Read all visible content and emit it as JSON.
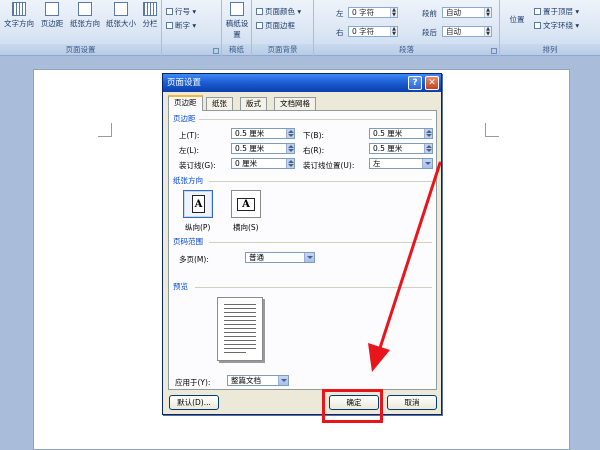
{
  "ribbon": {
    "page_setup": {
      "title": "页面设置",
      "text_direction": "文字方向",
      "margins": "页边距",
      "orientation": "纸张方向",
      "size": "纸张大小",
      "columns": "分栏",
      "line_numbers": "行号",
      "hyphenation": "断字"
    },
    "manuscript": {
      "title": "稿纸",
      "setup": "稿纸设置"
    },
    "page_background": {
      "title": "页面背景",
      "page_color": "页面颜色",
      "page_borders": "页面边框"
    },
    "paragraph": {
      "title": "段落",
      "left_label": "左",
      "left_value": "0 字符",
      "right_label": "右",
      "right_value": "0 字符",
      "before_label": "段前",
      "before_value": "自动",
      "after_label": "段后",
      "after_value": "自动"
    },
    "arrange": {
      "title": "排列",
      "position": "位置",
      "bring_front": "置于顶层",
      "text_wrap": "文字环绕"
    }
  },
  "dialog": {
    "title": "页面设置",
    "tabs": [
      "页边距",
      "纸张",
      "版式",
      "文档网格"
    ],
    "margins_section": "页边距",
    "top_label": "上(T):",
    "top_value": "0.5 厘米",
    "bottom_label": "下(B):",
    "bottom_value": "0.5 厘米",
    "left_label": "左(L):",
    "left_value": "0.5 厘米",
    "right_label": "右(R):",
    "right_value": "0.5 厘米",
    "gutter_label": "装订线(G):",
    "gutter_value": "0 厘米",
    "gutter_pos_label": "装订线位置(U):",
    "gutter_pos_value": "左",
    "orientation_section": "纸张方向",
    "portrait_label": "纵向(P)",
    "landscape_label": "横向(S)",
    "orient_glyph": "A",
    "pages_section": "页码范围",
    "multiple_pages_label": "多页(M):",
    "multiple_pages_value": "普通",
    "preview_section": "预览",
    "apply_to_label": "应用于(Y):",
    "apply_to_value": "整篇文档",
    "default_button": "默认(D)...",
    "ok_button": "确定",
    "cancel_button": "取消"
  },
  "annotation": {
    "color": "#e8151b"
  }
}
